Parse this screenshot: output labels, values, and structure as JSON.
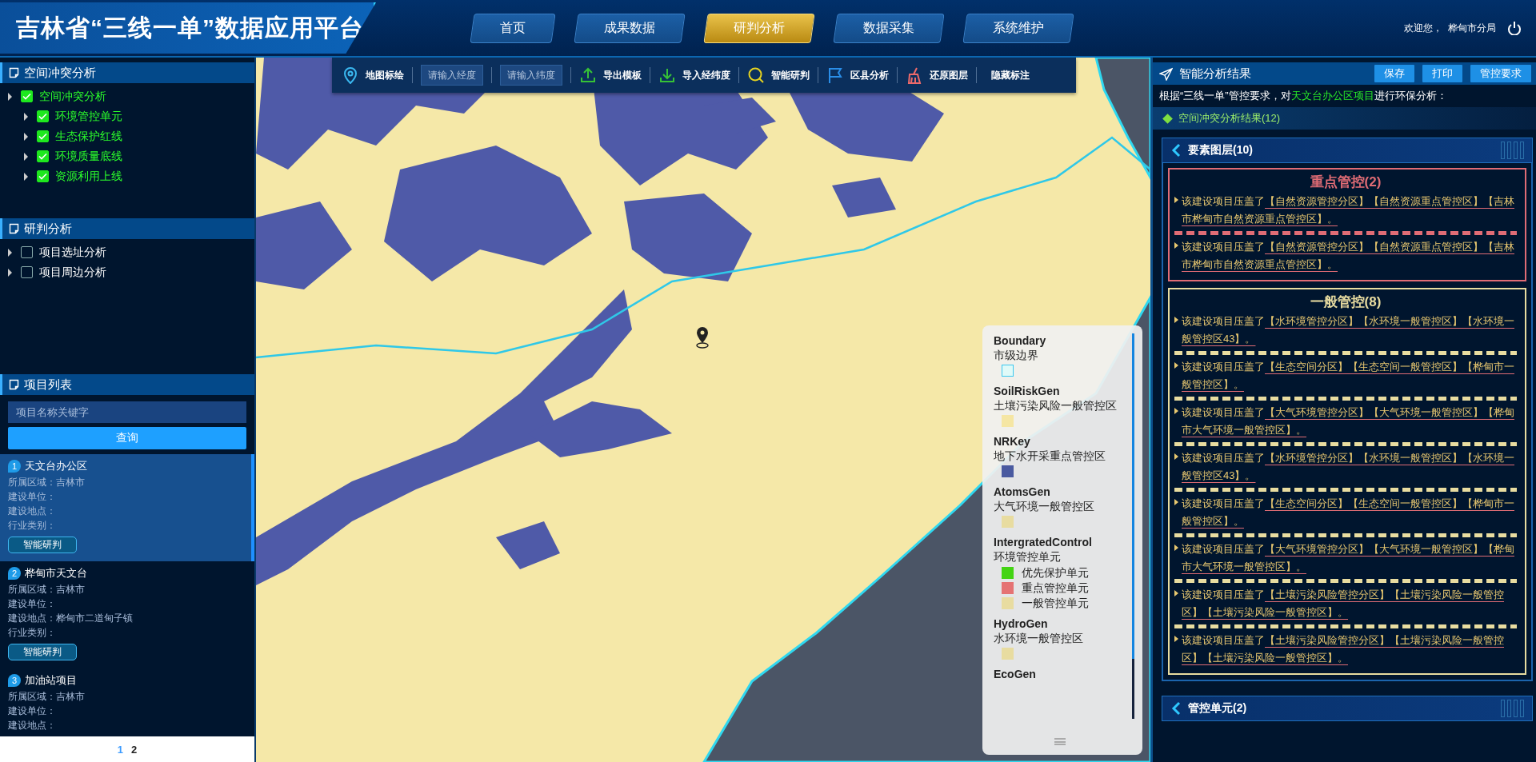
{
  "header": {
    "title": "吉林省“三线一单”数据应用平台",
    "nav": [
      {
        "label": "首页",
        "selected": false
      },
      {
        "label": "成果数据",
        "selected": false
      },
      {
        "label": "研判分析",
        "selected": true
      },
      {
        "label": "数据采集",
        "selected": false
      },
      {
        "label": "系统维护",
        "selected": false
      }
    ],
    "welcome": "欢迎您，  桦甸市分局"
  },
  "left_panel": {
    "sections": [
      {
        "title": "空间冲突分析",
        "tree": [
          {
            "label": "空间冲突分析",
            "checked": true,
            "children": [
              {
                "label": "环境管控单元",
                "checked": true
              },
              {
                "label": "生态保护红线",
                "checked": true
              },
              {
                "label": "环境质量底线",
                "checked": true
              },
              {
                "label": "资源利用上线",
                "checked": true
              }
            ]
          }
        ]
      },
      {
        "title": "研判分析",
        "tree": [
          {
            "label": "项目选址分析",
            "checked": false
          },
          {
            "label": "项目周边分析",
            "checked": false
          }
        ]
      }
    ],
    "project_list": {
      "title": "项目列表",
      "search": {
        "placeholder": "项目名称关键字"
      },
      "search_button": "查询",
      "projects": [
        {
          "number": "1",
          "name": "天文台办公区",
          "selected": true,
          "fields": [
            {
              "label": "所属区域：",
              "value": "吉林市"
            },
            {
              "label": "建设单位："
            },
            {
              "label": "建设地点："
            },
            {
              "label": "行业类别："
            }
          ],
          "action": "智能研判"
        },
        {
          "number": "2",
          "name": "桦甸市天文台",
          "selected": false,
          "fields": [
            {
              "label": "所属区域：",
              "value": "吉林市"
            },
            {
              "label": "建设单位："
            },
            {
              "label": "建设地点：",
              "value": "桦甸市二道甸子镇"
            },
            {
              "label": "行业类别："
            }
          ],
          "action": "智能研判"
        },
        {
          "number": "3",
          "name": "加油站项目",
          "selected": false,
          "fields": [
            {
              "label": "所属区域：",
              "value": "吉林市"
            },
            {
              "label": "建设单位："
            },
            {
              "label": "建设地点："
            }
          ]
        }
      ],
      "pages": [
        {
          "label": "1",
          "selected": true
        },
        {
          "label": "2",
          "selected": false
        }
      ]
    }
  },
  "map": {
    "toolbar": [
      {
        "kind": "tool",
        "label": "地图标绘"
      },
      {
        "kind": "input",
        "placeholder": "请输入经度"
      },
      {
        "kind": "input",
        "placeholder": "请输入纬度"
      },
      {
        "kind": "tool",
        "label": "导出模板"
      },
      {
        "kind": "tool",
        "label": "导入经纬度"
      },
      {
        "kind": "tool",
        "label": "智能研判"
      },
      {
        "kind": "tool",
        "label": "区县分析"
      },
      {
        "kind": "tool",
        "label": "还原图层"
      },
      {
        "kind": "text",
        "label": "隐藏标注"
      }
    ],
    "legend": [
      {
        "name": "Boundary",
        "description": "市级边界",
        "swatches": [
          {
            "kind": "outline",
            "color": "#e0faf8"
          }
        ]
      },
      {
        "name": "SoilRiskGen",
        "description": "土壤污染风险一般管控区",
        "swatches": [
          {
            "kind": "fill",
            "color": "#f5e6a3"
          }
        ]
      },
      {
        "name": "NRKey",
        "description": "地下水开采重点管控区",
        "swatches": [
          {
            "kind": "fill",
            "color": "#4a5aa0"
          }
        ]
      },
      {
        "name": "AtomsGen",
        "description": "大气环境一般管控区",
        "swatches": [
          {
            "kind": "fill",
            "color": "#e8dca0"
          }
        ]
      },
      {
        "name": "IntergratedControl",
        "description": "环境管控单元",
        "swatches": [
          {
            "kind": "fill",
            "color": "#44d414",
            "label": "优先保护单元"
          },
          {
            "kind": "fill",
            "color": "#e57373",
            "label": "重点管控单元"
          },
          {
            "kind": "fill",
            "color": "#e8dca0",
            "label": "一般管控单元"
          }
        ]
      },
      {
        "name": "HydroGen",
        "description": "水环境一般管控区",
        "swatches": [
          {
            "kind": "fill",
            "color": "#e8dca0"
          }
        ]
      },
      {
        "name": "EcoGen"
      }
    ]
  },
  "result_panel": {
    "title": "智能分析结果",
    "buttons": [
      "保存",
      "打印",
      "管控要求"
    ],
    "intro": {
      "before": "根据“三线一单”管控要求，对",
      "project": "天文台办公区项目",
      "after": "进行环保分析："
    },
    "summary": "空间冲突分析结果(12)",
    "layer_group": {
      "title": "要素图层(10)",
      "groups": [
        {
          "kind": "key",
          "title": "重点管控(2)",
          "items": [
            {
              "prefix": "该建设项目压盖了",
              "zones": "【自然资源管控分区】【自然资源重点管控区】【吉林市桦甸市自然资源重点管控区】。"
            },
            {
              "prefix": "该建设项目压盖了",
              "zones": "【自然资源管控分区】【自然资源重点管控区】【吉林市桦甸市自然资源重点管控区】。"
            }
          ]
        },
        {
          "kind": "general",
          "title": "一般管控(8)",
          "items": [
            {
              "prefix": "该建设项目压盖了",
              "zones": "【水环境管控分区】【水环境一般管控区】【水环境一般管控区43】。"
            },
            {
              "prefix": "该建设项目压盖了",
              "zones": "【生态空间分区】【生态空间一般管控区】【桦甸市一般管控区】。"
            },
            {
              "prefix": "该建设项目压盖了",
              "zones": "【大气环境管控分区】【大气环境一般管控区】【桦甸市大气环境一般管控区】。"
            },
            {
              "prefix": "该建设项目压盖了",
              "zones": "【水环境管控分区】【水环境一般管控区】【水环境一般管控区43】。"
            },
            {
              "prefix": "该建设项目压盖了",
              "zones": "【生态空间分区】【生态空间一般管控区】【桦甸市一般管控区】。"
            },
            {
              "prefix": "该建设项目压盖了",
              "zones": "【大气环境管控分区】【大气环境一般管控区】【桦甸市大气环境一般管控区】。"
            },
            {
              "prefix": "该建设项目压盖了",
              "zones": "【土壤污染风险管控分区】【土壤污染风险一般管控区】【土壤污染风险一般管控区】。"
            },
            {
              "prefix": "该建设项目压盖了",
              "zones": "【土壤污染风险管控分区】【土壤污染风险一般管控区】【土壤污染风险一般管控区】。"
            }
          ]
        }
      ]
    },
    "unit_group": {
      "title": "管控单元(2)"
    }
  }
}
